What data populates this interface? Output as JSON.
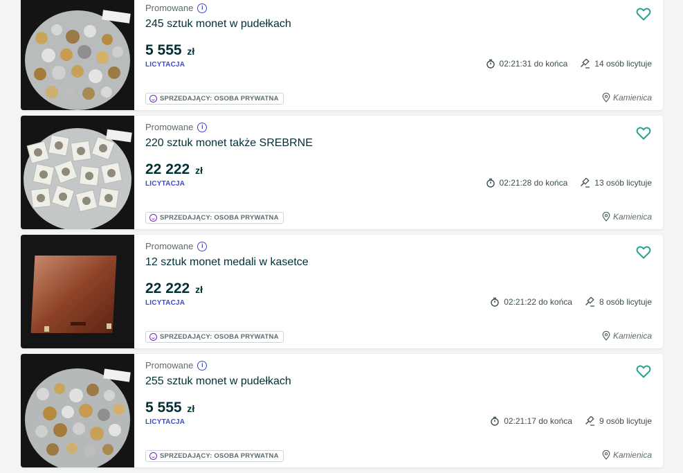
{
  "listings": [
    {
      "promo_label": "Promowane",
      "title": "245 sztuk monet w pudełkach",
      "price": "5 555",
      "currency": "zł",
      "type": "LICYTACJA",
      "time_left": "02:21:31 do końca",
      "bidders": "14 osób licytuje",
      "seller": "SPRZEDAJĄCY: OSOBA PRYWATNA",
      "location": "Kamienica",
      "photo": "coins-in-bag"
    },
    {
      "promo_label": "Promowane",
      "title": "220 sztuk monet także SREBRNE",
      "price": "22 222",
      "currency": "zł",
      "type": "LICYTACJA",
      "time_left": "02:21:28 do końca",
      "bidders": "13 osób licytuje",
      "seller": "SPRZEDAJĄCY: OSOBA PRYWATNA",
      "location": "Kamienica",
      "photo": "coin-holders-in-bag"
    },
    {
      "promo_label": "Promowane",
      "title": "12 sztuk monet medali w kasetce",
      "price": "22 222",
      "currency": "zł",
      "type": "LICYTACJA",
      "time_left": "02:21:22 do końca",
      "bidders": "8 osób licytuje",
      "seller": "SPRZEDAJĄCY: OSOBA PRYWATNA",
      "location": "Kamienica",
      "photo": "wooden-case"
    },
    {
      "promo_label": "Promowane",
      "title": "255 sztuk monet w pudełkach",
      "price": "5 555",
      "currency": "zł",
      "type": "LICYTACJA",
      "time_left": "02:21:17 do końca",
      "bidders": "9 osób licytuje",
      "seller": "SPRZEDAJĄCY: OSOBA PRYWATNA",
      "location": "Kamienica",
      "photo": "coins-in-bag"
    }
  ],
  "colors": {
    "accent": "#3a4bd4",
    "heart": "#23a08e",
    "seller_icon": "#6a2cb3"
  },
  "icons": {
    "info": "info-icon",
    "heart": "heart-icon",
    "timer": "timer-icon",
    "gavel": "gavel-icon",
    "location": "location-pin-icon",
    "seller": "smile-icon"
  }
}
